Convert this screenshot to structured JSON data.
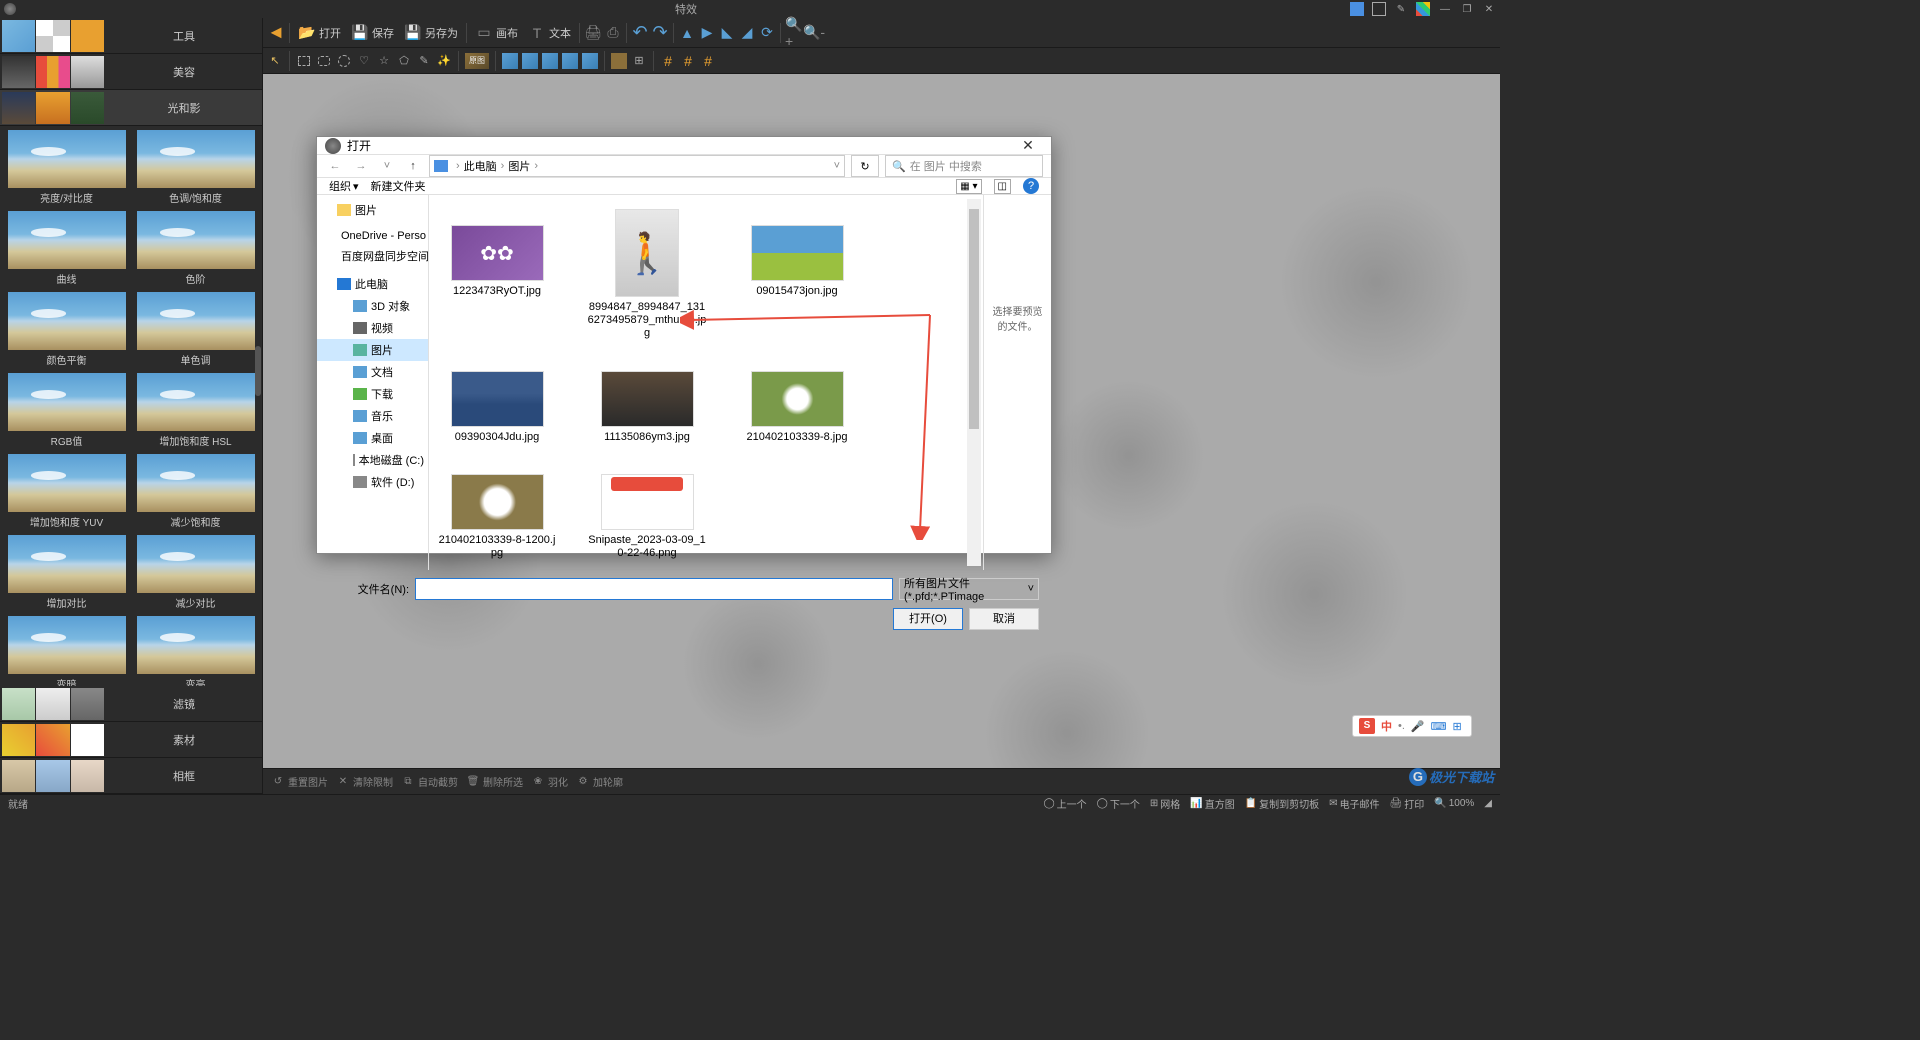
{
  "titlebar": {
    "title": "特效"
  },
  "sidebar": {
    "categories": [
      {
        "label": "工具"
      },
      {
        "label": "美容"
      },
      {
        "label": "光和影"
      },
      {
        "label": "滤镜"
      },
      {
        "label": "素材"
      },
      {
        "label": "相框"
      }
    ],
    "effects": [
      {
        "label": "亮度/对比度"
      },
      {
        "label": "色调/饱和度"
      },
      {
        "label": "曲线"
      },
      {
        "label": "色阶"
      },
      {
        "label": "颜色平衡"
      },
      {
        "label": "单色调"
      },
      {
        "label": "RGB值"
      },
      {
        "label": "增加饱和度 HSL"
      },
      {
        "label": "增加饱和度 YUV"
      },
      {
        "label": "减少饱和度"
      },
      {
        "label": "增加对比"
      },
      {
        "label": "减少对比"
      },
      {
        "label": "变暗"
      },
      {
        "label": "变亮"
      }
    ]
  },
  "toolbar": {
    "open": "打开",
    "save": "保存",
    "saveas": "另存为",
    "canvas": "画布",
    "text": "文本"
  },
  "toolbar2": {
    "original": "原图"
  },
  "bottom_toolbar": {
    "reset": "重置图片",
    "clear": "清除限制",
    "autocrop": "自动截剪",
    "delete": "删除所选",
    "feather": "羽化",
    "star": "加轮廓"
  },
  "statusbar": {
    "ready": "就绪",
    "prev": "上一个",
    "next": "下一个",
    "grid": "网格",
    "histogram": "直方图",
    "clipboard": "复制到剪切板",
    "email": "电子邮件",
    "print": "打印",
    "zoom": "100%"
  },
  "dialog": {
    "title": "打开",
    "breadcrumb": {
      "pc": "此电脑",
      "pics": "图片"
    },
    "search_placeholder": "在 图片 中搜索",
    "organize": "组织",
    "newfolder": "新建文件夹",
    "tree": {
      "pics": "图片",
      "onedrive": "OneDrive - Perso",
      "baidu": "百度网盘同步空间",
      "thispc": "此电脑",
      "obj3d": "3D 对象",
      "video": "视频",
      "pictures": "图片",
      "docs": "文档",
      "downloads": "下载",
      "music": "音乐",
      "desktop": "桌面",
      "diskc": "本地磁盘 (C:)",
      "diskd": "软件 (D:)"
    },
    "files": [
      {
        "name": "1223473RyOT.jpg"
      },
      {
        "name": "8994847_8994847_1316273495879_mthumb.jpg"
      },
      {
        "name": "09015473jon.jpg"
      },
      {
        "name": "09390304Jdu.jpg"
      },
      {
        "name": "11135086ym3.jpg"
      },
      {
        "name": "210402103339-8.jpg"
      },
      {
        "name": "210402103339-8-1200.jpg"
      },
      {
        "name": "Snipaste_2023-03-09_10-22-46.png"
      }
    ],
    "preview": "选择要预览的文件。",
    "filename_label": "文件名(N):",
    "filter": "所有图片文件 (*.pfd;*.PTimage",
    "open_btn": "打开(O)",
    "cancel_btn": "取消"
  },
  "ime": {
    "cn": "中"
  },
  "watermark": "极光下载站"
}
